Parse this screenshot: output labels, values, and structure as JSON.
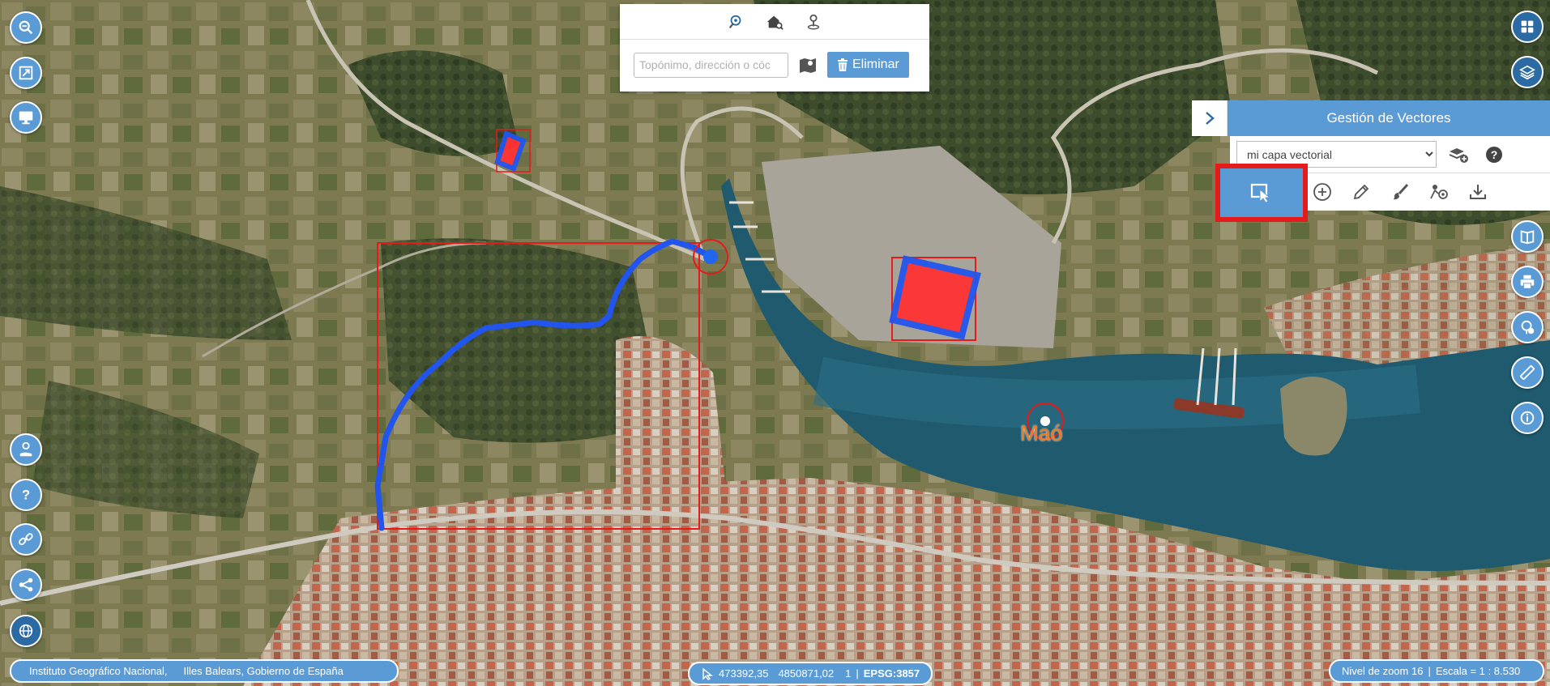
{
  "search": {
    "placeholder": "Topónimo, dirección o cóc",
    "value": "",
    "delete_label": "Eliminar",
    "tabs": [
      "search-location-icon",
      "house-search-icon",
      "pin-coordinates-icon"
    ]
  },
  "vector_panel": {
    "title": "Gestión de Vectores",
    "selected_layer": "mi capa vectorial",
    "tools": [
      "select-icon",
      "add-icon",
      "edit-pencil-icon",
      "style-brush-icon",
      "analysis-icon",
      "download-icon"
    ]
  },
  "map": {
    "place_name": "Maó"
  },
  "footer": {
    "attribution_1": "Instituto Geográfico Nacional,",
    "attribution_2": "Illes Balears, Gobierno de España",
    "coord_x": "473392,35",
    "coord_y": "4850871,02",
    "coord_count": "1",
    "crs": "EPSG:3857",
    "zoom_text": "Nivel de zoom 16",
    "scale_text": "Escala = 1 : 8.530"
  },
  "colors": {
    "accent": "#5b9bd5",
    "highlight_red": "#e51b1b",
    "vector_blue": "#2255ee",
    "vector_red": "#ff3333",
    "place_label": "#f07a1a"
  }
}
